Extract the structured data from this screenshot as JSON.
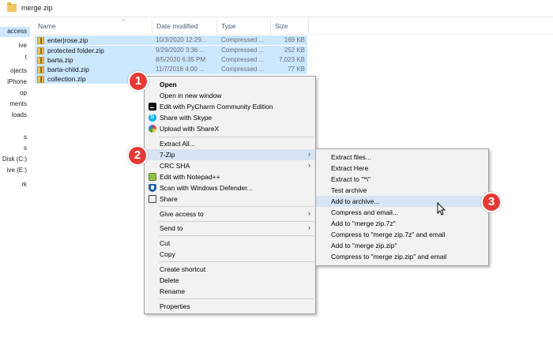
{
  "window": {
    "path": "merge zip",
    "path_separator": "›"
  },
  "nav": {
    "items": [
      {
        "label": "access",
        "selected": true
      },
      {
        "label": "ive"
      },
      {
        "label": "t"
      },
      {
        "label": "ojects"
      },
      {
        "label": "iPhone"
      },
      {
        "label": "op"
      },
      {
        "label": "ments"
      },
      {
        "label": "loads"
      },
      {
        "label": "s"
      },
      {
        "label": "s"
      },
      {
        "label": "Disk (C:)"
      },
      {
        "label": "ive (E:)"
      },
      {
        "label": "rk"
      }
    ]
  },
  "columns": {
    "name": "Name",
    "date": "Date modified",
    "type": "Type",
    "size": "Size"
  },
  "files": [
    {
      "name": "enter|rose.zip",
      "date": "10/3/2020 12:29...",
      "type": "Compressed ...",
      "size": "169 KB"
    },
    {
      "name": "protected folder.zip",
      "date": "9/29/2020 3:36 ...",
      "type": "Compressed ...",
      "size": "252 KB"
    },
    {
      "name": "barta.zip",
      "date": "8/5/2020 6:35 PM",
      "type": "Compressed ...",
      "size": "7,023 KB"
    },
    {
      "name": "barta-child.zip",
      "date": "11/7/2018 4:00 ...",
      "type": "Compressed ...",
      "size": "77 KB"
    },
    {
      "name": "collection.zip",
      "date": "",
      "type": "",
      "size": ""
    }
  ],
  "context_menu": {
    "open": "Open",
    "open_new_window": "Open in new window",
    "pycharm": "Edit with PyCharm Community Edition",
    "skype": "Share with Skype",
    "sharex": "Upload with ShareX",
    "extract_all": "Extract All...",
    "sevenzip": "7-Zip",
    "crc_sha": "CRC SHA",
    "notepad": "Edit with Notepad++",
    "defender": "Scan with Windows Defender...",
    "share": "Share",
    "give_access": "Give access to",
    "send_to": "Send to",
    "cut": "Cut",
    "copy": "Copy",
    "create_shortcut": "Create shortcut",
    "delete": "Delete",
    "rename": "Rename",
    "properties": "Properties"
  },
  "submenu": {
    "items": [
      "Extract files...",
      "Extract Here",
      "Extract to \"*\\\"",
      "Test archive",
      "Add to archive...",
      "Compress and email...",
      "Add to \"merge zip.7z\"",
      "Compress to \"merge zip.7z\" and email",
      "Add to \"merge zip.zip\"",
      "Compress to \"merge zip.zip\" and email"
    ],
    "highlighted": "Add to archive..."
  },
  "badges": [
    "1",
    "2",
    "3"
  ],
  "colors": {
    "selection": "#cce8ff",
    "menu_bg": "#f2f2f2",
    "menu_hover": "#d6e4f3",
    "badge": "#e53935"
  }
}
